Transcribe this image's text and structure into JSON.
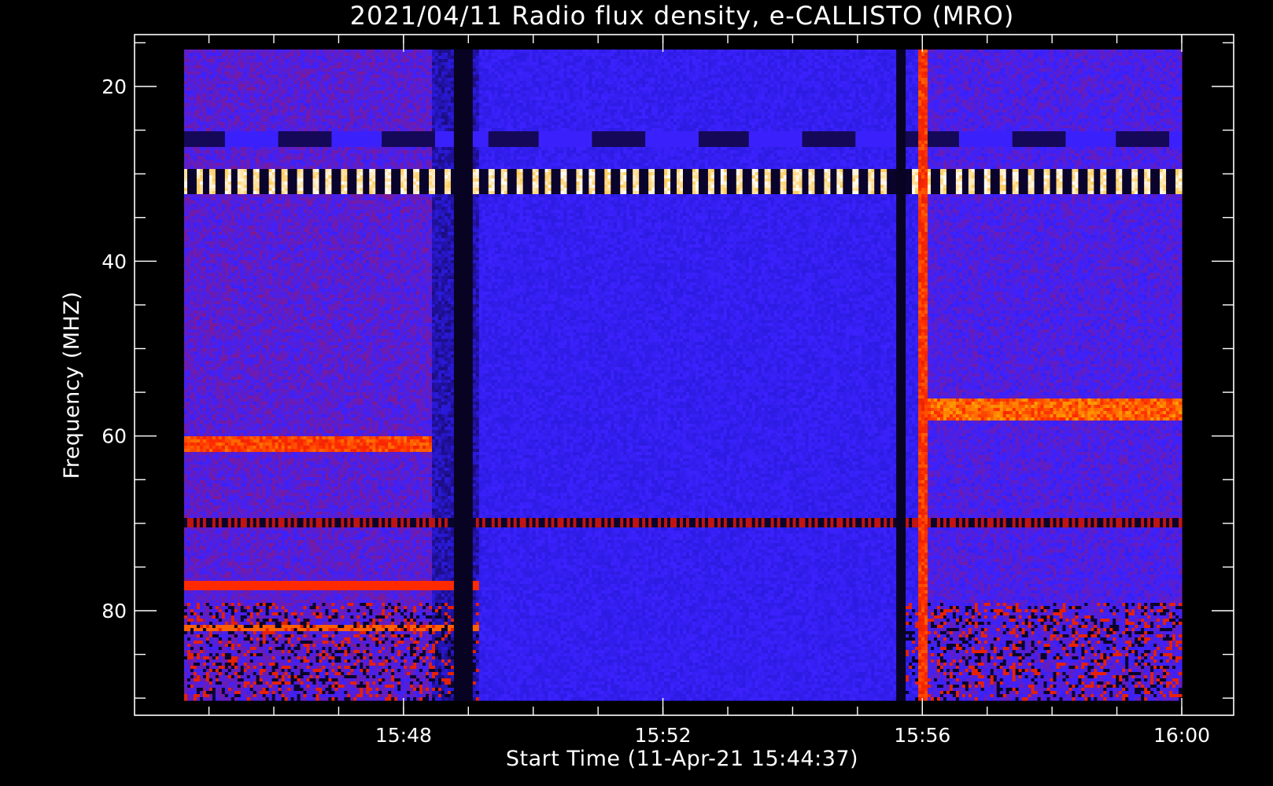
{
  "chart_data": {
    "type": "heatmap",
    "title": "2021/04/11  Radio flux density, e-CALLISTO (MRO)",
    "xlabel": "Start Time (11-Apr-21 15:44:37)",
    "ylabel": "Frequency (MHZ)",
    "x_ticks": [
      "15:48",
      "15:52",
      "15:56",
      "16:00"
    ],
    "y_ticks": [
      "20",
      "40",
      "60",
      "80"
    ],
    "xlim": [
      "15:44:37",
      "16:00:00"
    ],
    "ylim": [
      90,
      16
    ],
    "y_inverted": true,
    "colormap": [
      "#000000",
      "#1a0a6e",
      "#2a1adc",
      "#3c22ff",
      "#7a1a9c",
      "#c4140c",
      "#ff2a00",
      "#ffb000",
      "#ffffff"
    ],
    "features": [
      {
        "kind": "band",
        "freq_mhz": 31,
        "time": "15:44:37-16:00:00",
        "intensity": "very high, pulsed"
      },
      {
        "kind": "band",
        "freq_mhz": 26,
        "time": "15:44:37-16:00:00",
        "intensity": "dark striated"
      },
      {
        "kind": "band",
        "freq_mhz": 61,
        "time": "15:44:37-15:48:25",
        "intensity": "high"
      },
      {
        "kind": "band",
        "freq_mhz": 57,
        "time": "15:56:00-16:00:00",
        "intensity": "high"
      },
      {
        "kind": "band",
        "freq_mhz": 70,
        "time": "15:44:37-16:00:00",
        "intensity": "medium, dashed"
      },
      {
        "kind": "band",
        "freq_mhz": 77,
        "time": "15:44:37-15:49:10",
        "intensity": "high"
      },
      {
        "kind": "band",
        "freq_mhz": 82,
        "time": "15:44:37-15:49:10",
        "intensity": "high"
      },
      {
        "kind": "vertical",
        "time": "15:48:55",
        "intensity": "very low"
      },
      {
        "kind": "vertical",
        "time": "15:55:40",
        "intensity": "very low"
      },
      {
        "kind": "vertical",
        "time": "15:56:00",
        "intensity": "high"
      },
      {
        "kind": "region",
        "time": "15:44:37-15:48:25",
        "intensity": "elevated"
      },
      {
        "kind": "region",
        "time": "15:48:25-15:49:10",
        "intensity": "low"
      },
      {
        "kind": "region",
        "time": "15:49:10-15:55:40",
        "intensity": "baseline"
      },
      {
        "kind": "region",
        "time": "15:56:00-16:00:00",
        "intensity": "elevated"
      }
    ]
  }
}
